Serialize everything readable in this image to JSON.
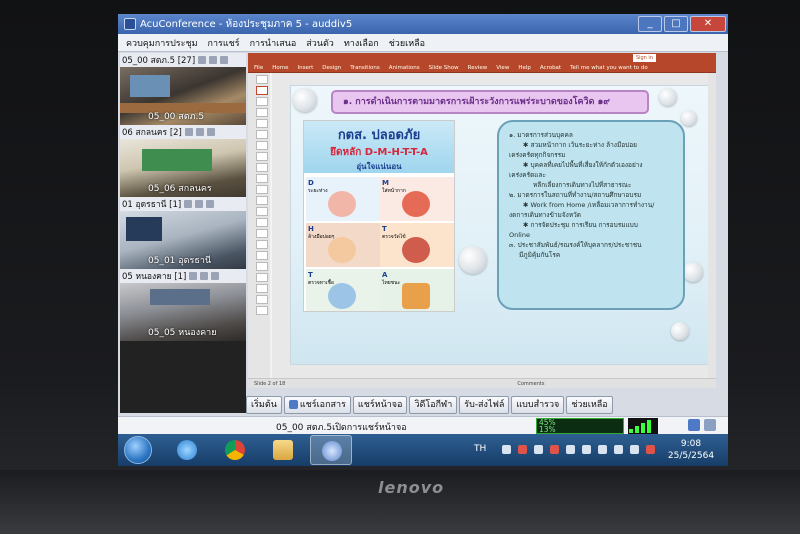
{
  "window": {
    "title": "AcuConference - ห้องประชุมภาค 5 - auddiv5",
    "min": "_",
    "max": "□",
    "close": "✕"
  },
  "menu": [
    "ควบคุมการประชุม",
    "การแชร์",
    "การนำเสนอ",
    "ส่วนตัว",
    "ทางเลือก",
    "ช่วยเหลือ"
  ],
  "participants": [
    {
      "header": "05_00 สตภ.5 [27]",
      "label": "05_00 สตภ.5"
    },
    {
      "header": "06 สกลนคร [2]",
      "label": "05_06 สกลนคร"
    },
    {
      "header": "01 อุดรธานี [1]",
      "label": "05_01 อุดรธานี"
    },
    {
      "header": "05 หนองคาย [1]",
      "label": "05_05 หนองคาย"
    }
  ],
  "ppt": {
    "ribbon_tabs": [
      "File",
      "Home",
      "Insert",
      "Design",
      "Transitions",
      "Animations",
      "Slide Show",
      "Review",
      "View",
      "Help",
      "Acrobat",
      "Tell me what you want to do"
    ],
    "signin": "Sign in",
    "status": [
      "Slide 2 of 18",
      "Comments"
    ],
    "slide": {
      "heading": "๑. การดำเนินการตามมาตรการเฝ้าระวังการแพร่ระบาดของโควิด ๑๙",
      "poster_title": "กตส. ปลอดภัย",
      "poster_subtitle": "ยึดหลัก D-M-H-T-T-A",
      "poster_tagline": "อุ่นใจแน่นอน",
      "tiles": [
        {
          "letter": "D",
          "text": "ระยะห่าง"
        },
        {
          "letter": "M",
          "text": "ใส่หน้ากาก"
        },
        {
          "letter": "H",
          "text": "ล้างมือบ่อยๆ"
        },
        {
          "letter": "T",
          "text": "ตรวจวัดไข้"
        },
        {
          "letter": "T",
          "text": "ตรวจหาเชื้อ"
        },
        {
          "letter": "A",
          "text": "ไทยชนะ"
        }
      ],
      "lines": [
        "๑. มาตรการส่วนบุคคล",
        "✱ สวมหน้ากาก เว้นระยะห่าง ล้างมือบ่อย",
        "เคร่งครัดทุกกิจกรรม",
        "✱ บุคคลที่เคยไปพื้นที่เสี่ยงให้กักตัวเองอย่าง",
        "เคร่งครัดและ",
        "หลีกเลี่ยงการเดินทางไปที่สาธารณะ",
        "๒. มาตรการในสถานที่ทำงาน/สถานศึกษาอบรม",
        "✱ Work from Home /เหลื่อมเวลาการทำงาน/",
        "งดการเดินทางข้ามจังหวัด",
        "✱ การจัดประชุม การเรียน การอบรมแบบ",
        "Online",
        "๓. ประชาสัมพันธ์/รณรงค์ให้บุคลากร/ประชาชน",
        "มีภูมิคุ้มกันโรค"
      ]
    }
  },
  "conf_buttons": [
    "เริ่มต้น",
    "แชร์เอกสาร",
    "แชร์หน้าจอ",
    "วิดีโอกีฬา",
    "รับ-ส่งไฟล์",
    "แบบสำรวจ",
    "ช่วยเหลือ"
  ],
  "status_text": "05_00 สตภ.5เปิดการแชร์หน้าจอ",
  "meter": [
    "45%",
    "13%"
  ],
  "taskbar": {
    "lang": "TH",
    "time": "9:08",
    "date": "25/5/2564"
  },
  "brand": "lenovo",
  "colors": {
    "ppt_red": "#b7472a",
    "taskbar": "#1f4a7a",
    "title_blue": "#3a64ad"
  }
}
